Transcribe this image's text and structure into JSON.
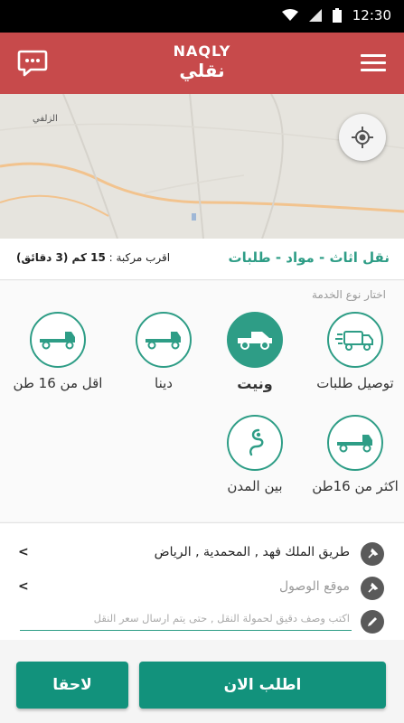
{
  "status_bar": {
    "time": "12:30",
    "icons": [
      "wifi-icon",
      "signal-icon",
      "battery-icon"
    ]
  },
  "app_bar": {
    "logo_en": "NAQLY",
    "logo_ar": "نقلي"
  },
  "map": {
    "place_label": "الزلفي"
  },
  "info": {
    "title": "نقل اثاث - مواد - طلبات",
    "nearest_prefix": "اقرب مركبة :",
    "nearest_value": "15 كم (3 دقائق)"
  },
  "services": {
    "heading": "اختار نوع الخدمة",
    "items": [
      {
        "label": "توصيل طلبات",
        "icon": "delivery-truck-icon",
        "selected": false
      },
      {
        "label": "ونيت",
        "icon": "pickup-icon",
        "selected": true
      },
      {
        "label": "دينا",
        "icon": "flatbed-truck-icon",
        "selected": false
      },
      {
        "label": "اقل من 16 طن",
        "icon": "flatbed-truck-icon",
        "selected": false
      },
      {
        "label": "اكثر من 16طن",
        "icon": "flatbed-truck-icon",
        "selected": false
      },
      {
        "label": "بين المدن",
        "icon": "route-icon",
        "selected": false
      }
    ]
  },
  "form": {
    "pickup": "طريق الملك فهد , المحمدية , الرياض",
    "destination_placeholder": "موقع الوصول",
    "description_placeholder": "اكتب وصف دقيق لحمولة النقل , حتى يتم ارسال سعر النقل",
    "chevron": "<"
  },
  "actions": {
    "order_now": "اطلب الان",
    "later": "لاحقا"
  },
  "colors": {
    "app_bar": "#c74a4b",
    "accent": "#2e9d86",
    "button": "#12927c"
  }
}
